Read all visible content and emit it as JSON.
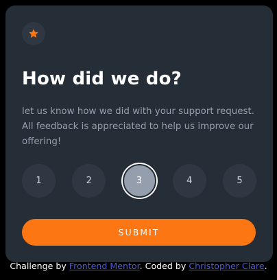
{
  "card": {
    "title": "How did we do?",
    "description": "let us know how we did with your support request. All feedback is appreciated to help us improve our offering!",
    "icon": "star-icon",
    "accent_color": "#fc7614"
  },
  "ratings": [
    {
      "label": "1",
      "selected": false
    },
    {
      "label": "2",
      "selected": false
    },
    {
      "label": "3",
      "selected": true
    },
    {
      "label": "4",
      "selected": false
    },
    {
      "label": "5",
      "selected": false
    }
  ],
  "submit": {
    "label": "SUBMIT"
  },
  "attribution": {
    "prefix": "Challenge by ",
    "link1": "Frontend Mentor",
    "middle": ". Coded by ",
    "link2": "Christopher Clare",
    "suffix": "."
  }
}
